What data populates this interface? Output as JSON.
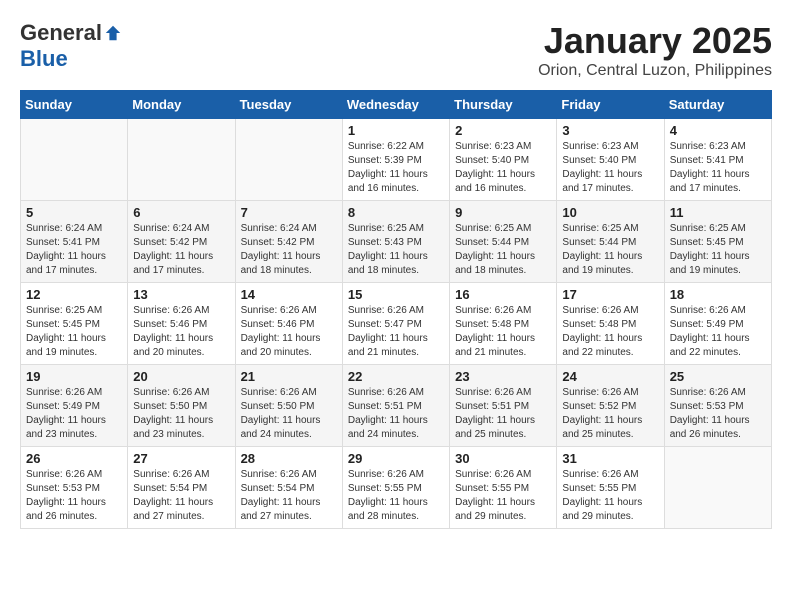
{
  "header": {
    "logo_general": "General",
    "logo_blue": "Blue",
    "month_title": "January 2025",
    "location": "Orion, Central Luzon, Philippines"
  },
  "weekdays": [
    "Sunday",
    "Monday",
    "Tuesday",
    "Wednesday",
    "Thursday",
    "Friday",
    "Saturday"
  ],
  "weeks": [
    [
      {
        "day": "",
        "sunrise": "",
        "sunset": "",
        "daylight": ""
      },
      {
        "day": "",
        "sunrise": "",
        "sunset": "",
        "daylight": ""
      },
      {
        "day": "",
        "sunrise": "",
        "sunset": "",
        "daylight": ""
      },
      {
        "day": "1",
        "sunrise": "Sunrise: 6:22 AM",
        "sunset": "Sunset: 5:39 PM",
        "daylight": "Daylight: 11 hours and 16 minutes."
      },
      {
        "day": "2",
        "sunrise": "Sunrise: 6:23 AM",
        "sunset": "Sunset: 5:40 PM",
        "daylight": "Daylight: 11 hours and 16 minutes."
      },
      {
        "day": "3",
        "sunrise": "Sunrise: 6:23 AM",
        "sunset": "Sunset: 5:40 PM",
        "daylight": "Daylight: 11 hours and 17 minutes."
      },
      {
        "day": "4",
        "sunrise": "Sunrise: 6:23 AM",
        "sunset": "Sunset: 5:41 PM",
        "daylight": "Daylight: 11 hours and 17 minutes."
      }
    ],
    [
      {
        "day": "5",
        "sunrise": "Sunrise: 6:24 AM",
        "sunset": "Sunset: 5:41 PM",
        "daylight": "Daylight: 11 hours and 17 minutes."
      },
      {
        "day": "6",
        "sunrise": "Sunrise: 6:24 AM",
        "sunset": "Sunset: 5:42 PM",
        "daylight": "Daylight: 11 hours and 17 minutes."
      },
      {
        "day": "7",
        "sunrise": "Sunrise: 6:24 AM",
        "sunset": "Sunset: 5:42 PM",
        "daylight": "Daylight: 11 hours and 18 minutes."
      },
      {
        "day": "8",
        "sunrise": "Sunrise: 6:25 AM",
        "sunset": "Sunset: 5:43 PM",
        "daylight": "Daylight: 11 hours and 18 minutes."
      },
      {
        "day": "9",
        "sunrise": "Sunrise: 6:25 AM",
        "sunset": "Sunset: 5:44 PM",
        "daylight": "Daylight: 11 hours and 18 minutes."
      },
      {
        "day": "10",
        "sunrise": "Sunrise: 6:25 AM",
        "sunset": "Sunset: 5:44 PM",
        "daylight": "Daylight: 11 hours and 19 minutes."
      },
      {
        "day": "11",
        "sunrise": "Sunrise: 6:25 AM",
        "sunset": "Sunset: 5:45 PM",
        "daylight": "Daylight: 11 hours and 19 minutes."
      }
    ],
    [
      {
        "day": "12",
        "sunrise": "Sunrise: 6:25 AM",
        "sunset": "Sunset: 5:45 PM",
        "daylight": "Daylight: 11 hours and 19 minutes."
      },
      {
        "day": "13",
        "sunrise": "Sunrise: 6:26 AM",
        "sunset": "Sunset: 5:46 PM",
        "daylight": "Daylight: 11 hours and 20 minutes."
      },
      {
        "day": "14",
        "sunrise": "Sunrise: 6:26 AM",
        "sunset": "Sunset: 5:46 PM",
        "daylight": "Daylight: 11 hours and 20 minutes."
      },
      {
        "day": "15",
        "sunrise": "Sunrise: 6:26 AM",
        "sunset": "Sunset: 5:47 PM",
        "daylight": "Daylight: 11 hours and 21 minutes."
      },
      {
        "day": "16",
        "sunrise": "Sunrise: 6:26 AM",
        "sunset": "Sunset: 5:48 PM",
        "daylight": "Daylight: 11 hours and 21 minutes."
      },
      {
        "day": "17",
        "sunrise": "Sunrise: 6:26 AM",
        "sunset": "Sunset: 5:48 PM",
        "daylight": "Daylight: 11 hours and 22 minutes."
      },
      {
        "day": "18",
        "sunrise": "Sunrise: 6:26 AM",
        "sunset": "Sunset: 5:49 PM",
        "daylight": "Daylight: 11 hours and 22 minutes."
      }
    ],
    [
      {
        "day": "19",
        "sunrise": "Sunrise: 6:26 AM",
        "sunset": "Sunset: 5:49 PM",
        "daylight": "Daylight: 11 hours and 23 minutes."
      },
      {
        "day": "20",
        "sunrise": "Sunrise: 6:26 AM",
        "sunset": "Sunset: 5:50 PM",
        "daylight": "Daylight: 11 hours and 23 minutes."
      },
      {
        "day": "21",
        "sunrise": "Sunrise: 6:26 AM",
        "sunset": "Sunset: 5:50 PM",
        "daylight": "Daylight: 11 hours and 24 minutes."
      },
      {
        "day": "22",
        "sunrise": "Sunrise: 6:26 AM",
        "sunset": "Sunset: 5:51 PM",
        "daylight": "Daylight: 11 hours and 24 minutes."
      },
      {
        "day": "23",
        "sunrise": "Sunrise: 6:26 AM",
        "sunset": "Sunset: 5:51 PM",
        "daylight": "Daylight: 11 hours and 25 minutes."
      },
      {
        "day": "24",
        "sunrise": "Sunrise: 6:26 AM",
        "sunset": "Sunset: 5:52 PM",
        "daylight": "Daylight: 11 hours and 25 minutes."
      },
      {
        "day": "25",
        "sunrise": "Sunrise: 6:26 AM",
        "sunset": "Sunset: 5:53 PM",
        "daylight": "Daylight: 11 hours and 26 minutes."
      }
    ],
    [
      {
        "day": "26",
        "sunrise": "Sunrise: 6:26 AM",
        "sunset": "Sunset: 5:53 PM",
        "daylight": "Daylight: 11 hours and 26 minutes."
      },
      {
        "day": "27",
        "sunrise": "Sunrise: 6:26 AM",
        "sunset": "Sunset: 5:54 PM",
        "daylight": "Daylight: 11 hours and 27 minutes."
      },
      {
        "day": "28",
        "sunrise": "Sunrise: 6:26 AM",
        "sunset": "Sunset: 5:54 PM",
        "daylight": "Daylight: 11 hours and 27 minutes."
      },
      {
        "day": "29",
        "sunrise": "Sunrise: 6:26 AM",
        "sunset": "Sunset: 5:55 PM",
        "daylight": "Daylight: 11 hours and 28 minutes."
      },
      {
        "day": "30",
        "sunrise": "Sunrise: 6:26 AM",
        "sunset": "Sunset: 5:55 PM",
        "daylight": "Daylight: 11 hours and 29 minutes."
      },
      {
        "day": "31",
        "sunrise": "Sunrise: 6:26 AM",
        "sunset": "Sunset: 5:55 PM",
        "daylight": "Daylight: 11 hours and 29 minutes."
      },
      {
        "day": "",
        "sunrise": "",
        "sunset": "",
        "daylight": ""
      }
    ]
  ]
}
